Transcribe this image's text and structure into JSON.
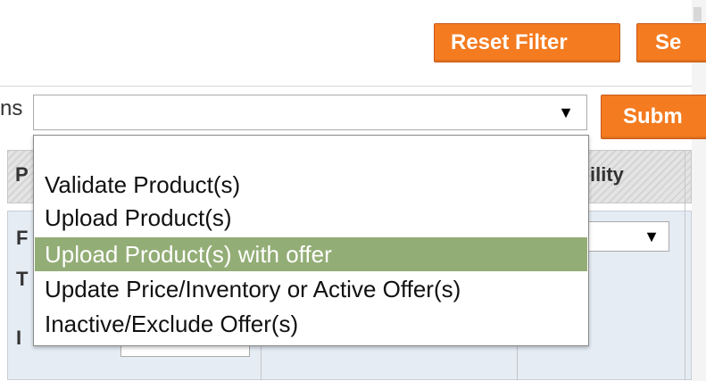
{
  "toolbar": {
    "reset_filter_label": "Reset Filter",
    "search_label_visible": "Se"
  },
  "actions": {
    "label_fragment": "ns",
    "selected_value": "",
    "submit_label_visible": "Subm",
    "options": [
      "Validate Product(s)",
      "Upload Product(s)",
      "Upload Product(s) with offer",
      "Update Price/Inventory or Active Offer(s)",
      "Inactive/Exclude Offer(s)"
    ],
    "highlighted_index": 2
  },
  "grid": {
    "header_fragment_left": "P",
    "header_fragment_visibility": "ility",
    "row_fragments": [
      "F",
      "T",
      "I"
    ]
  },
  "colors": {
    "button_orange": "#f47b20",
    "option_highlight": "#93ad76"
  },
  "icons": {
    "dropdown_arrow": "▼"
  }
}
